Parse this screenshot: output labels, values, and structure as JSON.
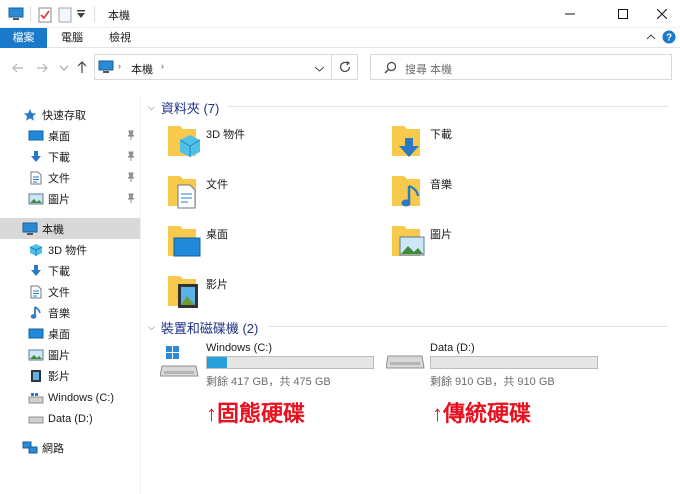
{
  "window": {
    "title": "本機"
  },
  "ribbon": {
    "tabs": [
      "檔案",
      "電腦",
      "檢視"
    ]
  },
  "address": {
    "crumb": "本機"
  },
  "search": {
    "placeholder": "搜尋 本機"
  },
  "sidebar": {
    "quick_access": "快速存取",
    "quick_items": [
      "桌面",
      "下載",
      "文件",
      "圖片"
    ],
    "this_pc": "本機",
    "pc_items": [
      "3D 物件",
      "下載",
      "文件",
      "音樂",
      "桌面",
      "圖片",
      "影片",
      "Windows (C:)",
      "Data (D:)"
    ],
    "network": "網路"
  },
  "folders": {
    "header": "資料夾 (7)",
    "items": [
      "3D 物件",
      "下載",
      "文件",
      "音樂",
      "桌面",
      "圖片",
      "影片"
    ]
  },
  "drives": {
    "header": "裝置和磁碟機 (2)",
    "items": [
      {
        "name": "Windows (C:)",
        "info": "剩餘 417 GB，共 475 GB",
        "used_fraction": 0.12
      },
      {
        "name": "Data (D:)",
        "info": "剩餘 910 GB，共 910 GB",
        "used_fraction": 0.0
      }
    ]
  },
  "annotations": [
    "↑固態硬碟",
    "↑傳統硬碟"
  ],
  "colors": {
    "accent": "#1979ca",
    "header_blue": "#1e3287",
    "bar_fill": "#26a0da",
    "annotation_red": "#e8101e",
    "folder": "#f7c94d"
  }
}
